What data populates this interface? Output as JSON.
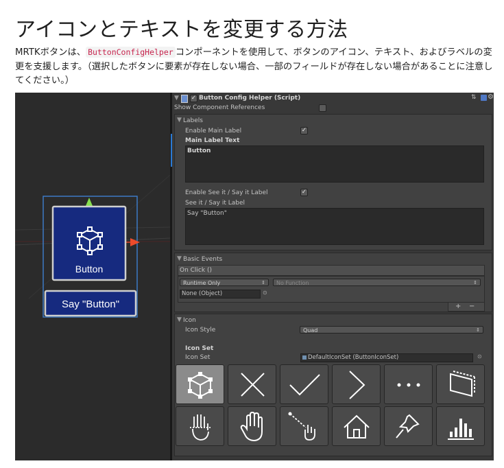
{
  "heading": "アイコンとテキストを変更する方法",
  "intro": {
    "before": "MRTKボタンは、",
    "code": "ButtonConfigHelper",
    "after": "コンポーネントを使用して、ボタンのアイコン、テキスト、およびラベルの変更を支援します。（選択したボタンに要素が存在しない場合、一部のフィールドが存在しない場合があることに注意してください。）"
  },
  "scene": {
    "button_label": "Button",
    "say_label": "Say \"Button\""
  },
  "inspector": {
    "component_title": "Button Config Helper (Script)",
    "show_refs": "Show Component References",
    "labels_header": "Labels",
    "enable_main": "Enable Main Label",
    "main_text_header": "Main Label Text",
    "main_text_value": "Button",
    "enable_seeit": "Enable See it / Say it Label",
    "seeit_header": "See it / Say it Label",
    "seeit_value": "Say \"Button\"",
    "basic_events_header": "Basic Events",
    "on_click": "On Click ()",
    "runtime": "Runtime Only",
    "no_function": "No Function",
    "none_object": "None (Object)",
    "plus": "+",
    "minus": "−",
    "icon_header": "Icon",
    "icon_style_label": "Icon Style",
    "icon_style_value": "Quad",
    "icon_set_header": "Icon Set",
    "icon_set_label": "Icon Set",
    "icon_set_value": "DefaultIconSet (ButtonIconSet)",
    "icons": [
      "cube-icon",
      "close-icon",
      "checkmark-icon",
      "chevron-right-icon",
      "more-icon",
      "adjust-icon",
      "hand-ray-icon",
      "hand-icon",
      "hand-pointer-icon",
      "home-icon",
      "pin-icon",
      "chart-icon"
    ]
  },
  "colors": {
    "button_blue": "#162a7f",
    "inspector_bg": "#383838",
    "scene_bg": "#2b2b2b",
    "code_red": "#c7254e"
  }
}
